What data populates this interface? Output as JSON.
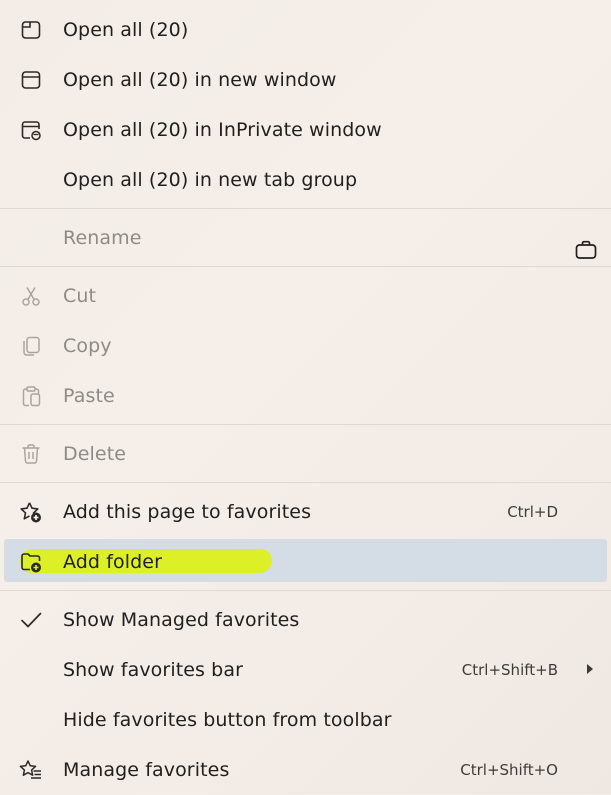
{
  "menu": {
    "items": [
      {
        "label": "Open all (20)",
        "shortcut": "",
        "icon": "tab-icon",
        "enabled": true
      },
      {
        "label": "Open all (20) in new window",
        "shortcut": "",
        "icon": "window-icon",
        "enabled": true
      },
      {
        "label": "Open all (20) in InPrivate window",
        "shortcut": "",
        "icon": "inprivate-window-icon",
        "enabled": true
      },
      {
        "label": "Open all (20) in new tab group",
        "shortcut": "",
        "icon": "",
        "enabled": true
      },
      {
        "label": "Rename",
        "shortcut": "",
        "icon": "",
        "enabled": false
      },
      {
        "label": "Cut",
        "shortcut": "",
        "icon": "scissors-icon",
        "enabled": false
      },
      {
        "label": "Copy",
        "shortcut": "",
        "icon": "copy-icon",
        "enabled": false
      },
      {
        "label": "Paste",
        "shortcut": "",
        "icon": "clipboard-icon",
        "enabled": false
      },
      {
        "label": "Delete",
        "shortcut": "",
        "icon": "trash-icon",
        "enabled": false
      },
      {
        "label": "Add this page to favorites",
        "shortcut": "Ctrl+D",
        "icon": "star-add-icon",
        "enabled": true
      },
      {
        "label": "Add folder",
        "shortcut": "",
        "icon": "folder-add-icon",
        "enabled": true,
        "selected": true
      },
      {
        "label": "Show Managed favorites",
        "shortcut": "",
        "icon": "checkmark-icon",
        "enabled": true,
        "checked": true
      },
      {
        "label": "Show favorites bar",
        "shortcut": "Ctrl+Shift+B",
        "icon": "",
        "enabled": true,
        "has_submenu": true
      },
      {
        "label": "Hide favorites button from toolbar",
        "shortcut": "",
        "icon": "",
        "enabled": true
      },
      {
        "label": "Manage favorites",
        "shortcut": "Ctrl+Shift+O",
        "icon": "favorites-list-icon",
        "enabled": true
      }
    ],
    "colors": {
      "selected_background": "#d4dde6",
      "highlighter_mark": "#dcef1c",
      "disabled_text": "#8e8a87"
    }
  }
}
